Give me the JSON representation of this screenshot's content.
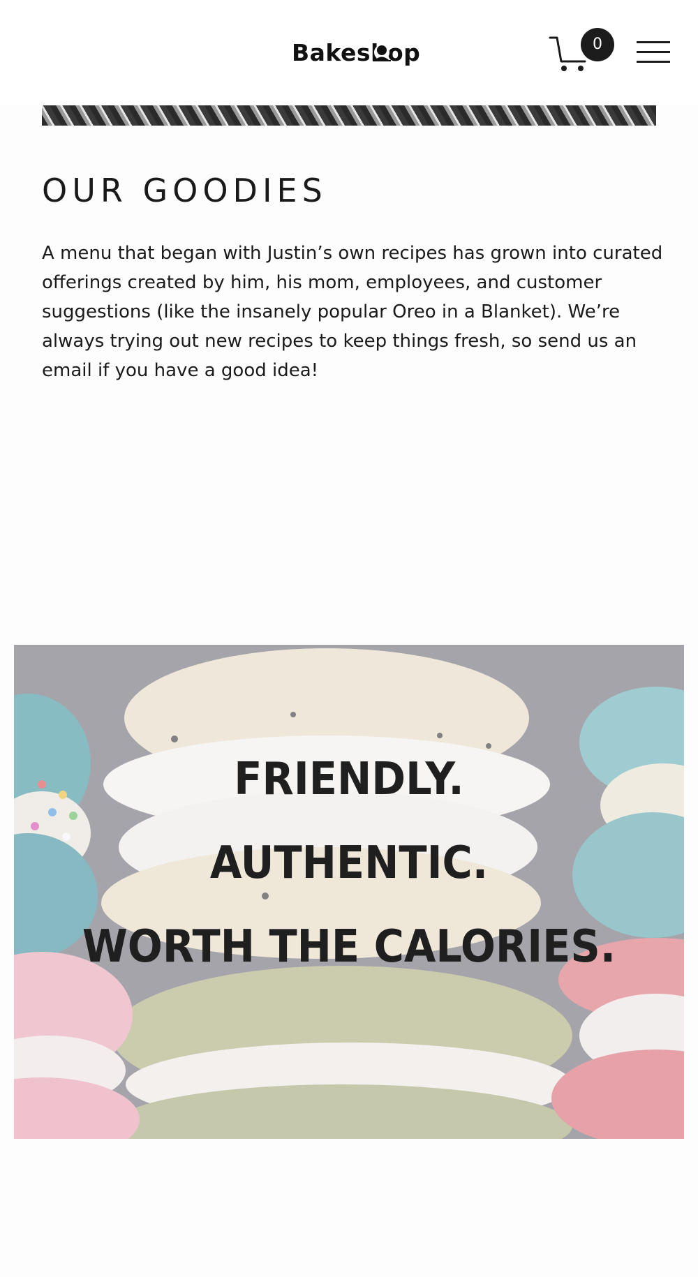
{
  "header": {
    "logo_text": "Bakeshop",
    "logo_icon": "chef-mark-icon",
    "cart_icon": "shopping-cart-icon",
    "cart_count": "0",
    "menu_icon": "hamburger-menu-icon"
  },
  "goodies": {
    "title": "OUR GOODIES",
    "body": "A menu that began with Justin’s own recipes has grown into curated offerings created by him, his mom, employees, and customer suggestions (like the insanely popular Oreo in a Blanket). We’re always trying out new recipes to keep things fresh, so send us an email if you have a good idea!"
  },
  "hero": {
    "lines": [
      "FRIENDLY.",
      "AUTHENTIC.",
      "WORTH THE CALORIES."
    ]
  },
  "colors": {
    "text": "#1a1a1a",
    "badge": "#1c1c1c",
    "background": "#fdfdfd"
  }
}
